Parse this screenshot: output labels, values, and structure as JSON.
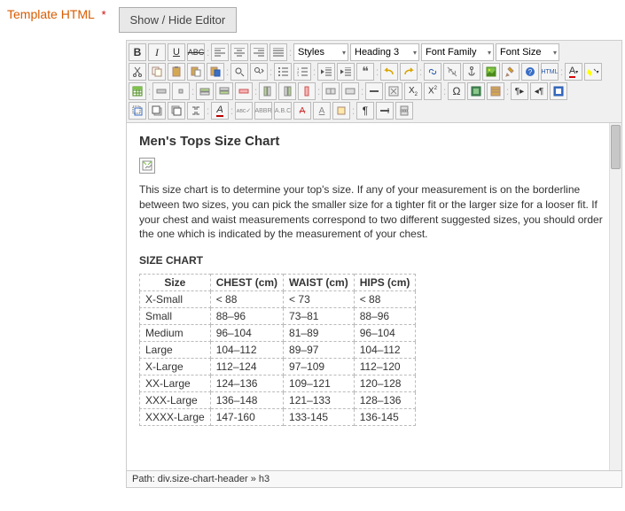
{
  "field_label": "Template HTML",
  "required_marker": "*",
  "toggle_button": "Show / Hide Editor",
  "selects": {
    "styles": "Styles",
    "format": "Heading 3",
    "font_family": "Font Family",
    "font_size": "Font Size"
  },
  "content": {
    "title": "Men's Tops Size Chart",
    "intro": "This size chart is to determine your top's size. If any of your measurement is on the borderline between two sizes, you can pick the smaller size for a tighter fit or the larger size for a looser fit. If your chest and waist measurements correspond to two different suggested sizes, you should order the one which is indicated by the measurement of your chest.",
    "section_label": "SIZE CHART",
    "table_headers": [
      "Size",
      "CHEST (cm)",
      "WAIST (cm)",
      "HIPS (cm)"
    ],
    "table_rows": [
      [
        "X-Small",
        "< 88",
        "< 73",
        "< 88"
      ],
      [
        "Small",
        "88–96",
        "73–81",
        "88–96"
      ],
      [
        "Medium",
        "96–104",
        "81–89",
        "96–104"
      ],
      [
        "Large",
        "104–112",
        "89–97",
        "104–112"
      ],
      [
        "X-Large",
        "112–124",
        "97–109",
        "112–120"
      ],
      [
        "XX-Large",
        "124–136",
        "109–121",
        "120–128"
      ],
      [
        "XXX-Large",
        "136–148",
        "121–133",
        "128–136"
      ],
      [
        "XXXX-Large",
        "147-160",
        "133-145",
        "136-145"
      ]
    ]
  },
  "path": "Path: div.size-chart-header » h3"
}
